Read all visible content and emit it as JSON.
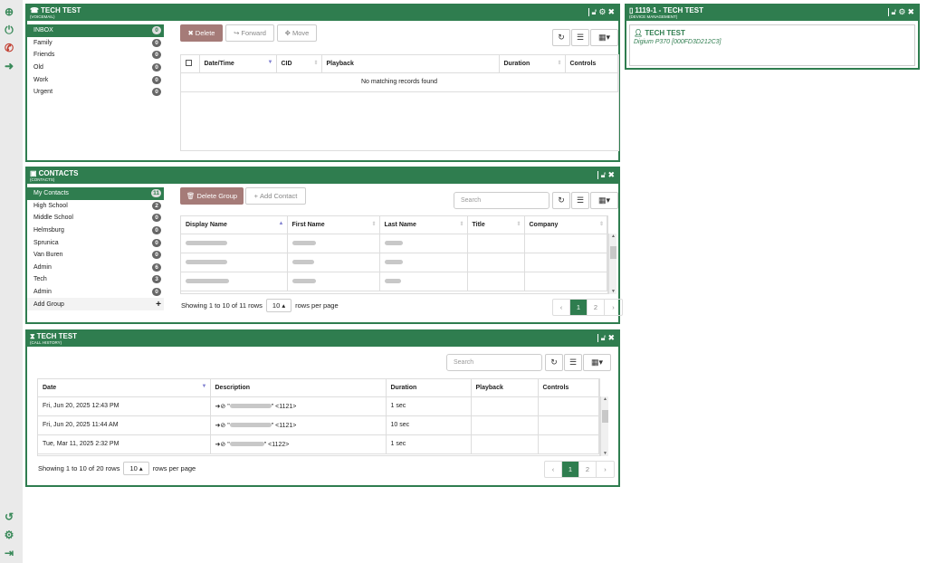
{
  "colors": {
    "primary": "#2f7d4f",
    "danger_button": "#a57b78",
    "sidebar": "#eaeaea"
  },
  "left_toolbar": {
    "top_icons": [
      "plus-circle-icon",
      "power-icon",
      "phone-icon",
      "arrow-right-icon"
    ],
    "bottom_icons": [
      "refresh-icon",
      "gear-icon",
      "sign-out-icon"
    ]
  },
  "voicemail": {
    "title": "TECH TEST",
    "subtitle": "(VOICEMAIL)",
    "folders": [
      {
        "label": "INBOX",
        "count": "0"
      },
      {
        "label": "Family",
        "count": "0"
      },
      {
        "label": "Friends",
        "count": "0"
      },
      {
        "label": "Old",
        "count": "0"
      },
      {
        "label": "Work",
        "count": "0"
      },
      {
        "label": "Urgent",
        "count": "0"
      }
    ],
    "buttons": {
      "delete": "Delete",
      "forward": "Forward",
      "move": "Move"
    },
    "columns": [
      "Date/Time",
      "CID",
      "Playback",
      "Duration",
      "Controls"
    ],
    "empty_message": "No matching records found"
  },
  "device": {
    "title": "1119-1 - TECH TEST",
    "subtitle": "(DEVICE MANAGEMENT)",
    "user_name": "TECH TEST",
    "device_model": "Digium P370 [000FD3D212C3]"
  },
  "contacts": {
    "title": "CONTACTS",
    "subtitle": "(CONTACTS)",
    "groups": [
      {
        "label": "My Contacts",
        "count": "11"
      },
      {
        "label": "High School",
        "count": "2"
      },
      {
        "label": "Middle School",
        "count": "0"
      },
      {
        "label": "Helmsburg",
        "count": "0"
      },
      {
        "label": "Sprunica",
        "count": "0"
      },
      {
        "label": "Van Buren",
        "count": "0"
      },
      {
        "label": "Admin",
        "count": "6"
      },
      {
        "label": "Tech",
        "count": "3"
      },
      {
        "label": "Admin",
        "count": "0"
      }
    ],
    "add_group": "Add Group",
    "buttons": {
      "delete_group": "Delete Group",
      "add_contact": "Add Contact"
    },
    "search_placeholder": "Search",
    "columns": [
      "Display Name",
      "First Name",
      "Last Name",
      "Title",
      "Company"
    ],
    "pager": {
      "summary": "Showing 1 to 10 of 11 rows",
      "page_size": "10",
      "rows_per_page": "rows per page",
      "pages": [
        "1",
        "2"
      ],
      "prev": "‹",
      "next": "›"
    }
  },
  "call_history": {
    "title": "TECH TEST",
    "subtitle": "(CALL HISTORY)",
    "search_placeholder": "Search",
    "columns": [
      "Date",
      "Description",
      "Duration",
      "Playback",
      "Controls"
    ],
    "rows": [
      {
        "date": "Fri, Jun 20, 2025 12:43 PM",
        "ext": "\" <1121>",
        "duration": "1 sec"
      },
      {
        "date": "Fri, Jun 20, 2025 11:44 AM",
        "ext": "\" <1121>",
        "duration": "10 sec"
      },
      {
        "date": "Tue, Mar 11, 2025 2:32 PM",
        "ext": "\" <1122>",
        "duration": "1 sec"
      }
    ],
    "pager": {
      "summary": "Showing 1 to 10 of 20 rows",
      "page_size": "10",
      "rows_per_page": "rows per page",
      "pages": [
        "1",
        "2"
      ],
      "prev": "‹",
      "next": "›"
    }
  }
}
